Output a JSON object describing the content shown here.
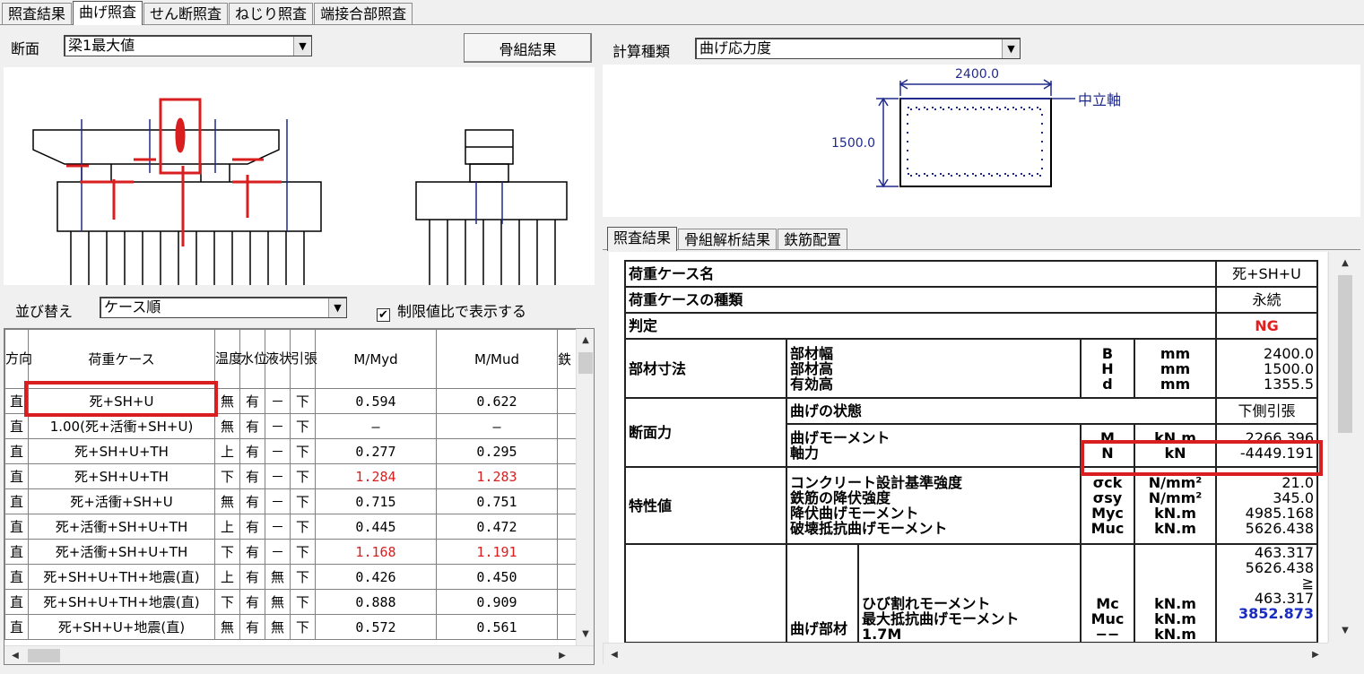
{
  "top_tabs": [
    "照査結果",
    "曲げ照査",
    "せん断照査",
    "ねじり照査",
    "端接合部照査"
  ],
  "active_top_tab": 1,
  "left": {
    "section_label": "断面",
    "section_value": "梁1最大値",
    "frame_button": "骨組結果",
    "sort_label": "並び替え",
    "sort_value": "ケース順",
    "limit_checkbox_label": "制限値比で表示する",
    "limit_checked": "✔"
  },
  "table": {
    "headers": {
      "dir": "方向",
      "case": "荷重ケース",
      "temp": "温度",
      "water": "水位",
      "liq": "液状",
      "tension": "引張",
      "m1": "M/Myd",
      "m2": "M/Mud",
      "extra": "鉄"
    },
    "rows": [
      {
        "dir": "直",
        "case": "死+SH+U",
        "temp": "無",
        "water": "有",
        "liq": "－",
        "ten": "下",
        "m1": "0.594",
        "m2": "0.622",
        "red": false
      },
      {
        "dir": "直",
        "case": "1.00(死+活衝+SH+U)",
        "temp": "無",
        "water": "有",
        "liq": "－",
        "ten": "下",
        "m1": "—",
        "m2": "—",
        "red": false
      },
      {
        "dir": "直",
        "case": "死+SH+U+TH",
        "temp": "上",
        "water": "有",
        "liq": "－",
        "ten": "下",
        "m1": "0.277",
        "m2": "0.295",
        "red": false
      },
      {
        "dir": "直",
        "case": "死+SH+U+TH",
        "temp": "下",
        "water": "有",
        "liq": "－",
        "ten": "下",
        "m1": "1.284",
        "m2": "1.283",
        "red": true
      },
      {
        "dir": "直",
        "case": "死+活衝+SH+U",
        "temp": "無",
        "water": "有",
        "liq": "－",
        "ten": "下",
        "m1": "0.715",
        "m2": "0.751",
        "red": false
      },
      {
        "dir": "直",
        "case": "死+活衝+SH+U+TH",
        "temp": "上",
        "water": "有",
        "liq": "－",
        "ten": "下",
        "m1": "0.445",
        "m2": "0.472",
        "red": false
      },
      {
        "dir": "直",
        "case": "死+活衝+SH+U+TH",
        "temp": "下",
        "water": "有",
        "liq": "－",
        "ten": "下",
        "m1": "1.168",
        "m2": "1.191",
        "red": true
      },
      {
        "dir": "直",
        "case": "死+SH+U+TH+地震(直)",
        "temp": "上",
        "water": "有",
        "liq": "無",
        "ten": "下",
        "m1": "0.426",
        "m2": "0.450",
        "red": false
      },
      {
        "dir": "直",
        "case": "死+SH+U+TH+地震(直)",
        "temp": "下",
        "water": "有",
        "liq": "無",
        "ten": "下",
        "m1": "0.888",
        "m2": "0.909",
        "red": false
      },
      {
        "dir": "直",
        "case": "死+SH+U+地震(直)",
        "temp": "無",
        "water": "有",
        "liq": "無",
        "ten": "下",
        "m1": "0.572",
        "m2": "0.561",
        "red": false
      }
    ]
  },
  "right": {
    "calc_label": "計算種類",
    "calc_value": "曲げ応力度",
    "dim_width": "2400.0",
    "dim_height": "1500.0",
    "neutral_axis": "中立軸",
    "tabs": [
      "照査結果",
      "骨組解析結果",
      "鉄筋配置"
    ],
    "active_tab": 0
  },
  "result": {
    "case_name_label": "荷重ケース名",
    "case_name": "死+SH+U",
    "case_type_label": "荷重ケースの種類",
    "case_type": "永続",
    "judge_label": "判定",
    "judge": "NG",
    "dims_label": "部材寸法",
    "dims": [
      {
        "name": "部材幅",
        "sym": "B",
        "unit": "mm",
        "val": "2400.0"
      },
      {
        "name": "部材高",
        "sym": "H",
        "unit": "mm",
        "val": "1500.0"
      },
      {
        "name": "有効高",
        "sym": "d",
        "unit": "mm",
        "val": "1355.5"
      }
    ],
    "force_label": "断面力",
    "bend_state_label": "曲げの状態",
    "bend_state": "下側引張",
    "forces": [
      {
        "name": "曲げモーメント",
        "sym": "M",
        "unit": "kN.m",
        "val": "2266.396"
      },
      {
        "name": "軸力",
        "sym": "N",
        "unit": "kN",
        "val": "-4449.191"
      }
    ],
    "prop_label": "特性値",
    "props": [
      {
        "name": "コンクリート設計基準強度",
        "sym": "σck",
        "unit": "N/mm²",
        "val": "21.0"
      },
      {
        "name": "鉄筋の降伏強度",
        "sym": "σsy",
        "unit": "N/mm²",
        "val": "345.0"
      },
      {
        "name": "降伏曲げモーメント",
        "sym": "Myc",
        "unit": "kN.m",
        "val": "4985.168"
      },
      {
        "name": "破壊抵抗曲げモーメント",
        "sym": "Muc",
        "unit": "kN.m",
        "val": "5626.438"
      }
    ],
    "bend_part_label": "曲げ部材",
    "bend": [
      {
        "name": "ひび割れモーメント",
        "sym": "Mc",
        "unit": "kN.m",
        "val": "463.317"
      },
      {
        "name": "最大抵抗曲げモーメント",
        "sym": "Muc",
        "unit": "kN.m",
        "val": "5626.438"
      },
      {
        "name": "1.7M",
        "sym": "−−",
        "unit": "kN.m",
        "val": "3852.873"
      }
    ],
    "bend_top_vals": [
      "463.317",
      "5626.438",
      "≧",
      "463.317"
    ]
  },
  "colors": {
    "highlight": "#d81e1e",
    "diagram_blue": "#1f2a8c",
    "ng": "#e02020",
    "link_blue": "#1a2cc4"
  }
}
